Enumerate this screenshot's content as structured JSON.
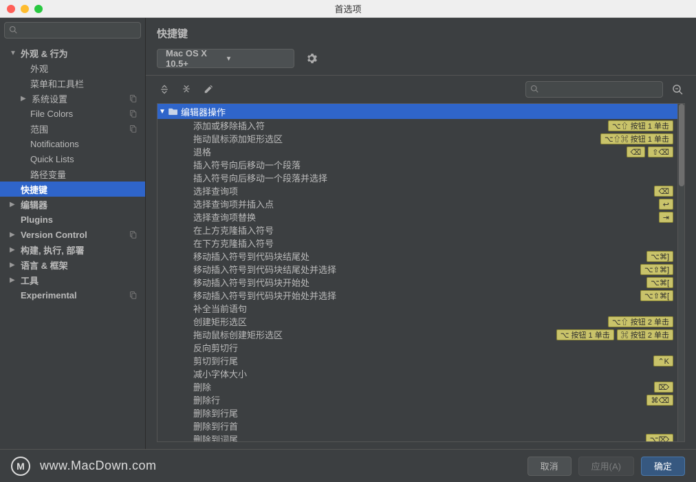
{
  "window": {
    "title": "首选项"
  },
  "sidebar": {
    "search_placeholder": "",
    "tree": [
      {
        "label": "外观 & 行为",
        "level": 1,
        "arrow": "open",
        "bold": true
      },
      {
        "label": "外观",
        "level": 2
      },
      {
        "label": "菜单和工具栏",
        "level": 2
      },
      {
        "label": "系统设置",
        "level": 2,
        "arrow": "closed",
        "badge": true
      },
      {
        "label": "File Colors",
        "level": 2,
        "badge": true
      },
      {
        "label": "范围",
        "level": 2,
        "badge": true
      },
      {
        "label": "Notifications",
        "level": 2
      },
      {
        "label": "Quick Lists",
        "level": 2
      },
      {
        "label": "路径变量",
        "level": 2
      },
      {
        "label": "快捷键",
        "level": 1,
        "bold": true,
        "selected": true
      },
      {
        "label": "编辑器",
        "level": 1,
        "arrow": "closed",
        "bold": true
      },
      {
        "label": "Plugins",
        "level": 1,
        "bold": true
      },
      {
        "label": "Version Control",
        "level": 1,
        "arrow": "closed",
        "bold": true,
        "badge": true
      },
      {
        "label": "构建, 执行, 部署",
        "level": 1,
        "arrow": "closed",
        "bold": true
      },
      {
        "label": "语言 & 框架",
        "level": 1,
        "arrow": "closed",
        "bold": true
      },
      {
        "label": "工具",
        "level": 1,
        "arrow": "closed",
        "bold": true
      },
      {
        "label": "Experimental",
        "level": 1,
        "bold": true,
        "badge": true
      }
    ]
  },
  "content": {
    "title": "快捷键",
    "keymap_selected": "Mac OS X 10.5+",
    "search_placeholder": "",
    "group_label": "编辑器操作",
    "actions": [
      {
        "label": "添加或移除插入符",
        "shortcuts": [
          "⌥⇧ 按钮 1 单击"
        ]
      },
      {
        "label": "拖动鼠标添加矩形选区",
        "shortcuts": [
          "⌥⇧⌘ 按钮 1 单击"
        ]
      },
      {
        "label": "退格",
        "shortcuts": [
          "⌫",
          "⇧⌫"
        ]
      },
      {
        "label": "插入符号向后移动一个段落",
        "shortcuts": []
      },
      {
        "label": "插入符号向后移动一个段落并选择",
        "shortcuts": []
      },
      {
        "label": "选择查询项",
        "shortcuts": [
          "⌫"
        ]
      },
      {
        "label": "选择查询项并插入点",
        "shortcuts": [
          "↩"
        ]
      },
      {
        "label": "选择查询项替换",
        "shortcuts": [
          "⇥"
        ]
      },
      {
        "label": "在上方克隆插入符号",
        "shortcuts": []
      },
      {
        "label": "在下方克隆插入符号",
        "shortcuts": []
      },
      {
        "label": "移动插入符号到代码块结尾处",
        "shortcuts": [
          "⌥⌘]"
        ]
      },
      {
        "label": "移动插入符号到代码块结尾处并选择",
        "shortcuts": [
          "⌥⇧⌘]"
        ]
      },
      {
        "label": "移动插入符号到代码块开始处",
        "shortcuts": [
          "⌥⌘["
        ]
      },
      {
        "label": "移动插入符号到代码块开始处并选择",
        "shortcuts": [
          "⌥⇧⌘["
        ]
      },
      {
        "label": "补全当前语句",
        "shortcuts": []
      },
      {
        "label": "创建矩形选区",
        "shortcuts": [
          "⌥⇧ 按钮 2 单击"
        ]
      },
      {
        "label": "拖动鼠标创建矩形选区",
        "shortcuts": [
          "⌥ 按钮 1 单击",
          "⌘ 按钮 2 单击"
        ]
      },
      {
        "label": "反向剪切行",
        "shortcuts": []
      },
      {
        "label": "剪切到行尾",
        "shortcuts": [
          "⌃K"
        ]
      },
      {
        "label": "减小字体大小",
        "shortcuts": []
      },
      {
        "label": "删除",
        "shortcuts": [
          "⌦"
        ]
      },
      {
        "label": "删除行",
        "shortcuts": [
          "⌘⌫"
        ]
      },
      {
        "label": "删除到行尾",
        "shortcuts": []
      },
      {
        "label": "删除到行首",
        "shortcuts": []
      },
      {
        "label": "删除到词尾",
        "shortcuts": [
          "⌥⌦"
        ]
      }
    ]
  },
  "footer": {
    "watermark_text": "www.MacDown.com",
    "cancel": "取消",
    "apply": "应用(A)",
    "ok": "确定"
  }
}
